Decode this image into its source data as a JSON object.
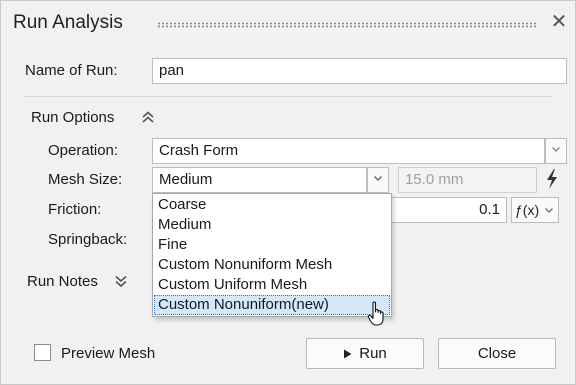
{
  "dialog": {
    "title": "Run Analysis",
    "close_glyph": "✕"
  },
  "run_name": {
    "label": "Name of Run:",
    "value": "pan"
  },
  "run_options": {
    "label": "Run Options",
    "expand_icon": "chevron-double-up-icon",
    "operation": {
      "label": "Operation:",
      "value": "Crash Form"
    },
    "mesh_size": {
      "label": "Mesh Size:",
      "value": "Medium",
      "size_value": "15.0 mm",
      "options": [
        "Coarse",
        "Medium",
        "Fine",
        "Custom Nonuniform Mesh",
        "Custom Uniform Mesh",
        "Custom Nonuniform(new)"
      ],
      "highlighted_option": "Custom Nonuniform(new)"
    },
    "friction": {
      "label": "Friction:",
      "value": "0.1",
      "function_glyph": "ƒ(x)"
    },
    "springback": {
      "label": "Springback:"
    }
  },
  "run_notes": {
    "label": "Run Notes",
    "expand_icon": "chevron-double-down-icon"
  },
  "footer": {
    "preview_mesh_label": "Preview Mesh",
    "preview_mesh_checked": false,
    "run_label": "Run",
    "close_label": "Close"
  },
  "colors": {
    "dialog_bg": "#f1f1f1",
    "highlight_bg": "#d4e8fa",
    "highlight_border": "#3a75b5"
  }
}
